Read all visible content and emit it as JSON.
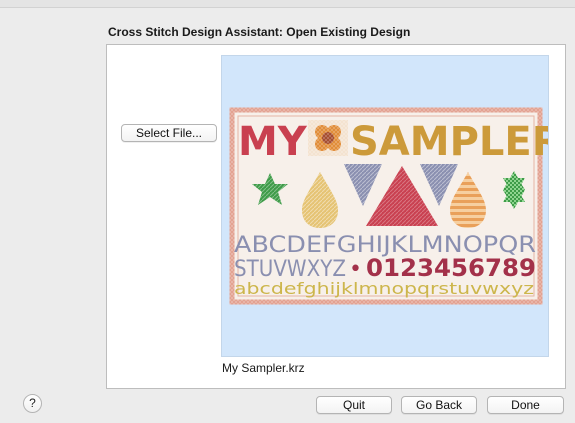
{
  "dialog": {
    "title": "Cross Stitch Design Assistant: Open Existing Design"
  },
  "file_picker": {
    "select_label": "Select File...",
    "filename": "My Sampler.krz"
  },
  "preview": {
    "background_color": "#d2e6fb",
    "sampler": {
      "title_part1": "MY",
      "title_part2": "SAMPLER",
      "uppercase_line1": "ABCDEFGHIJKLMNOPQR",
      "uppercase_line2_letters": "STUVWXYZ",
      "bullet": "•",
      "numbers": "0123456789",
      "lowercase_line": "abcdefghijklmnopqrstuvwxyz",
      "colors": {
        "frame": "#e2a08f",
        "red": "#c94050",
        "green": "#3e9b48",
        "yellow": "#cdb64c",
        "orange": "#e9a05a",
        "grey_blue": "#8a8fb0",
        "maroon": "#a3314a"
      }
    }
  },
  "footer": {
    "help_label": "?",
    "quit_label": "Quit",
    "back_label": "Go Back",
    "done_label": "Done"
  }
}
